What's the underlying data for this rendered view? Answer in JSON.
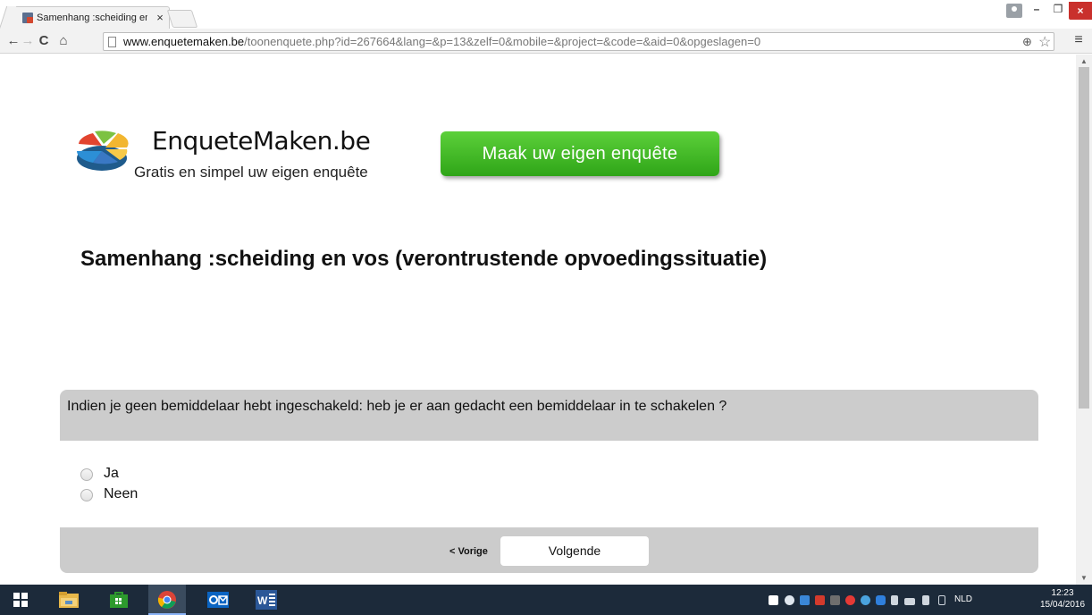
{
  "browser": {
    "tab_title": "Samenhang :scheiding en vos (verontrustende opvoedingssituatie)",
    "tab_close": "×",
    "url_host": "www.enquetemaken.be",
    "url_path": "/toonenquete.php?id=267664&lang=&p=13&zelf=0&mobile=&project=&code=&aid=0&opgeslagen=0",
    "nav_back": "←",
    "nav_forward": "→",
    "nav_reload": "C",
    "nav_home": "⌂",
    "zoom_icon": "⊕",
    "star_icon": "☆",
    "menu_icon": "≡",
    "win_min": "–",
    "win_max": "❐",
    "win_close": "×"
  },
  "page": {
    "logo_title": "EnqueteMaken.be",
    "logo_tagline": "Gratis en simpel uw eigen enquête",
    "cta_label": "Maak uw eigen enquête",
    "survey_title": "Samenhang :scheiding en vos (verontrustende opvoedingssituatie)",
    "question": "Indien je geen bemiddelaar hebt ingeschakeld: heb je er aan gedacht een bemiddelaar in te schakelen ?",
    "answers": [
      "Ja",
      "Neen"
    ],
    "prev_label": "< Vorige",
    "next_label": "Volgende"
  },
  "taskbar": {
    "language": "NLD",
    "time": "12:23",
    "date": "15/04/2016",
    "apps": [
      "start-icon",
      "file-explorer-icon",
      "store-icon",
      "chrome-icon",
      "outlook-icon",
      "word-icon"
    ]
  },
  "colors": {
    "cta_green": "#3cb824",
    "panel_gray": "#cccccc",
    "taskbar": "#1c2a3a",
    "close_red": "#c9302c"
  }
}
